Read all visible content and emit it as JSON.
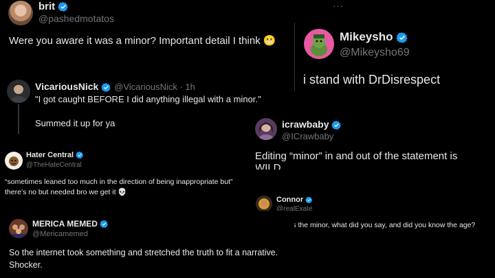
{
  "tweets": {
    "brit": {
      "name": "brit",
      "handle": "@pashedmotatos",
      "text": "Were you aware it was a minor? Important detail I think 😬",
      "more": "···"
    },
    "mikeysho": {
      "name": "Mikeysho",
      "handle": "@Mikeysho69",
      "text": "i stand with DrDisrespect"
    },
    "vicarious": {
      "name": "VicariousNick",
      "handle": "@VicariousNick · 1h",
      "text": "\"I got caught BEFORE I did anything illegal with a minor.\"",
      "text2": "Summed it up for ya"
    },
    "icrawbaby": {
      "name": "icrawbaby",
      "handle": "@ICrawbaby",
      "text": "Editing “minor” in and out of the statement is WILD"
    },
    "hater": {
      "name": "Hater Central",
      "handle": "@TheHateCentral",
      "text": "“sometimes leaned too much in the direction of being inappropriate but”\nthere’s no but needed bro we get it 💀"
    },
    "connor": {
      "name": "Connor",
      "handle": "@realExate",
      "text": "How old was the minor, what did you say, and did you know the age?"
    },
    "merica": {
      "name": "MERICA MEMED",
      "handle": "@Mericamemed",
      "text": "So the internet took something and stretched the truth to fit a narrative.\nShocker."
    }
  },
  "colors": {
    "background": "#000000",
    "text": "#e7e9ea",
    "handle": "#71767b",
    "verified": "#1d9bf0"
  }
}
